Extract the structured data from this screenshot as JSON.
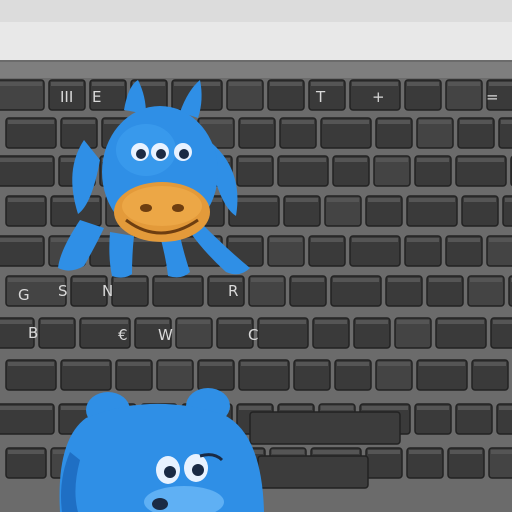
{
  "image": {
    "description_kind": "photo-style render",
    "colors": {
      "backdrop": "#e8e8e8",
      "keyboard_frame": "#6e6e6e",
      "key_face": "#3a3a3a",
      "key_edge": "#222222",
      "mascot_blue": "#2f8fe6",
      "mascot_shadow": "#1f6fc4",
      "snout_orange": "#e39a3a"
    }
  },
  "keyboard": {
    "rows": [
      [
        "",
        "",
        "III",
        "E",
        "",
        "",
        "",
        "",
        "T",
        "+",
        "",
        "",
        "",
        "",
        "=",
        ""
      ],
      [
        "",
        "",
        "",
        "",
        "",
        "",
        "",
        "",
        "",
        "",
        "",
        ""
      ],
      [
        "",
        "",
        "",
        "",
        "",
        "",
        "",
        "",
        "",
        "",
        "",
        "",
        ""
      ],
      [
        "",
        "",
        "",
        "",
        "",
        "",
        "",
        "",
        "",
        "",
        "",
        "",
        ""
      ],
      [
        "",
        "",
        "",
        "",
        "",
        "",
        "",
        "",
        "",
        "",
        "",
        "",
        ""
      ],
      [
        "G",
        "S",
        "N",
        "",
        "R",
        "",
        "",
        "",
        "",
        "",
        ""
      ],
      [
        "B",
        "",
        "€",
        "W",
        "",
        "C",
        "",
        "",
        "",
        "",
        ""
      ],
      [
        "",
        "",
        "",
        "",
        "",
        "",
        "",
        "",
        "",
        "",
        "",
        ""
      ],
      [
        "",
        "",
        "",
        "",
        "",
        "",
        "",
        "",
        "",
        "",
        ""
      ]
    ],
    "top_row_labels": [
      "III",
      "E",
      "T",
      "+",
      "="
    ],
    "middle_labels": [
      "G",
      "S",
      "N",
      "R"
    ],
    "lower_labels": [
      "B",
      "€",
      "W",
      "C"
    ]
  },
  "mascots": [
    {
      "name": "upper-blue-mascot",
      "color": "blue",
      "icon": "donkey-mascot"
    },
    {
      "name": "lower-blue-mascot",
      "color": "blue",
      "icon": "bear-mascot"
    }
  ]
}
